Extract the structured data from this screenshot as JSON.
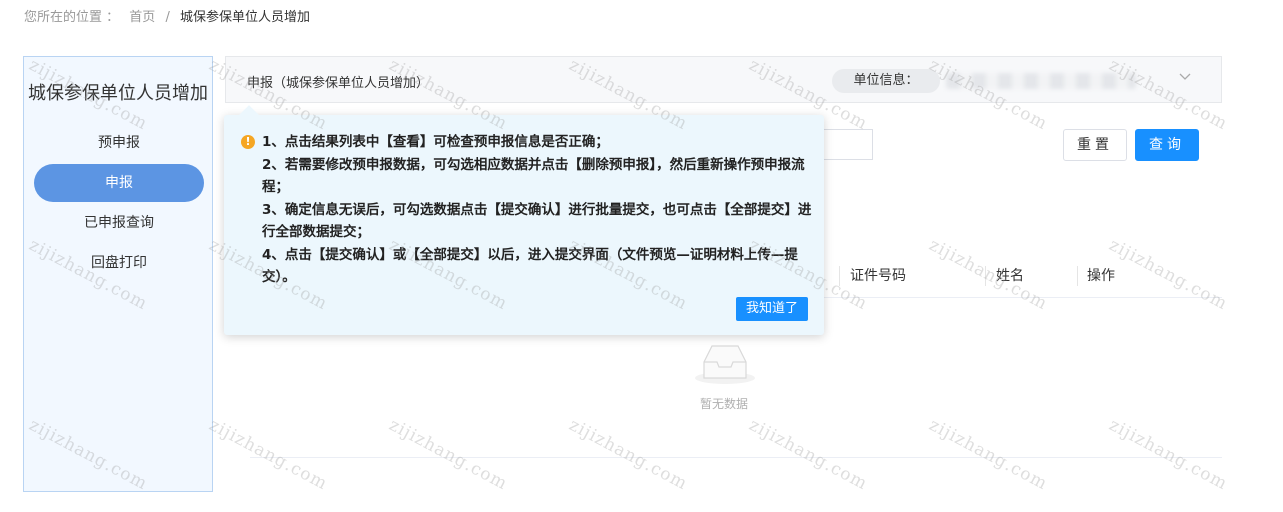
{
  "breadcrumb": {
    "prefix": "您所在的位置 ：",
    "home": "首页",
    "separator": "/",
    "current": "城保参保单位人员增加"
  },
  "sidebar": {
    "title": "城保参保单位人员增加",
    "items": [
      {
        "label": "预申报",
        "active": false
      },
      {
        "label": "申报",
        "active": true
      },
      {
        "label": "已申报查询",
        "active": false
      },
      {
        "label": "回盘打印",
        "active": false
      }
    ]
  },
  "topbar": {
    "title": "申报（城保参保单位人员增加）",
    "unit_label": "单位信息："
  },
  "toolbar": {
    "reset_label": "重置",
    "search_label": "查询"
  },
  "table": {
    "columns": [
      "证件号码",
      "姓名",
      "操作"
    ],
    "empty_text": "暂无数据"
  },
  "tip": {
    "lines": [
      "1、点击结果列表中【查看】可检查预申报信息是否正确；",
      "2、若需要修改预申报数据，可勾选相应数据并点击【删除预申报】，然后重新操作预申报流程；",
      "3、确定信息无误后，可勾选数据点击【提交确认】进行批量提交，也可点击【全部提交】进行全部数据提交；",
      "4、点击【提交确认】或【全部提交】以后，进入提交界面（文件预览—证明材料上传—提交）。"
    ],
    "button_label": "我知道了"
  },
  "watermark": "zijizhang.com",
  "colors": {
    "primary": "#1890ff",
    "sidebar_active": "#5c95e3",
    "sidebar_bg": "#f2f8ff",
    "tip_bg": "#ecf7fd",
    "warning": "#f5a623"
  }
}
